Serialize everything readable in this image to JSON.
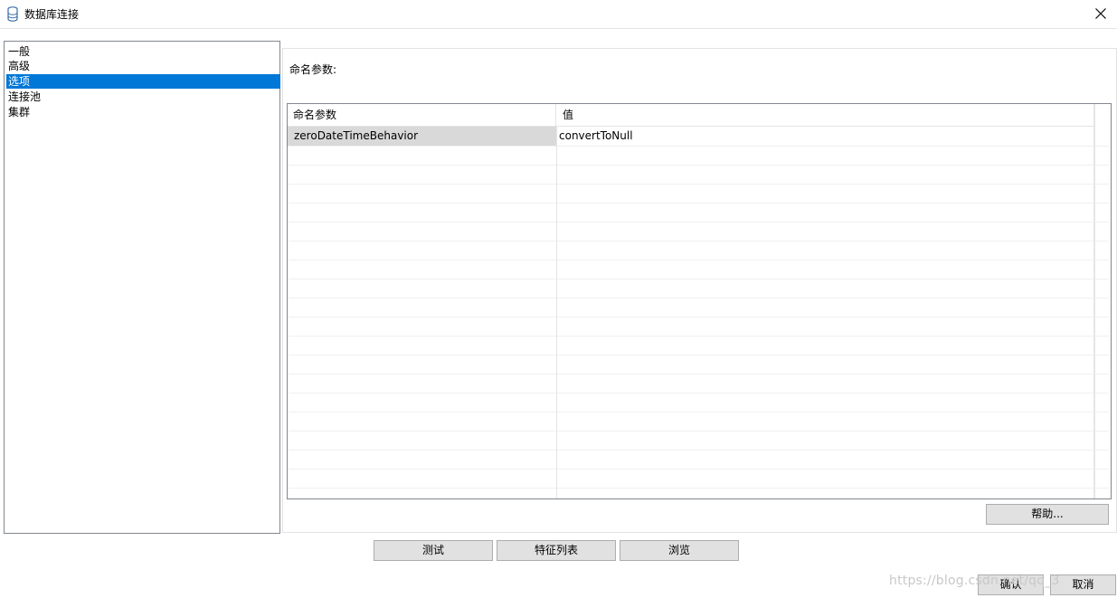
{
  "window": {
    "title": "数据库连接",
    "icon": "database-icon"
  },
  "nav": {
    "items": [
      "一般",
      "高级",
      "选项",
      "连接池",
      "集群"
    ],
    "selected_index": 2
  },
  "panel": {
    "label": "命名参数:",
    "grid": {
      "columns": [
        "命名参数",
        "值"
      ],
      "rows": [
        {
          "name": "zeroDateTimeBehavior",
          "value": "convertToNull"
        }
      ]
    },
    "help_label": "帮助..."
  },
  "footer": {
    "test_label": "测试",
    "features_label": "特征列表",
    "browse_label": "浏览",
    "ok_label": "确认",
    "cancel_label": "取消"
  },
  "watermark": "https://blog.csdn.net/qq_3"
}
